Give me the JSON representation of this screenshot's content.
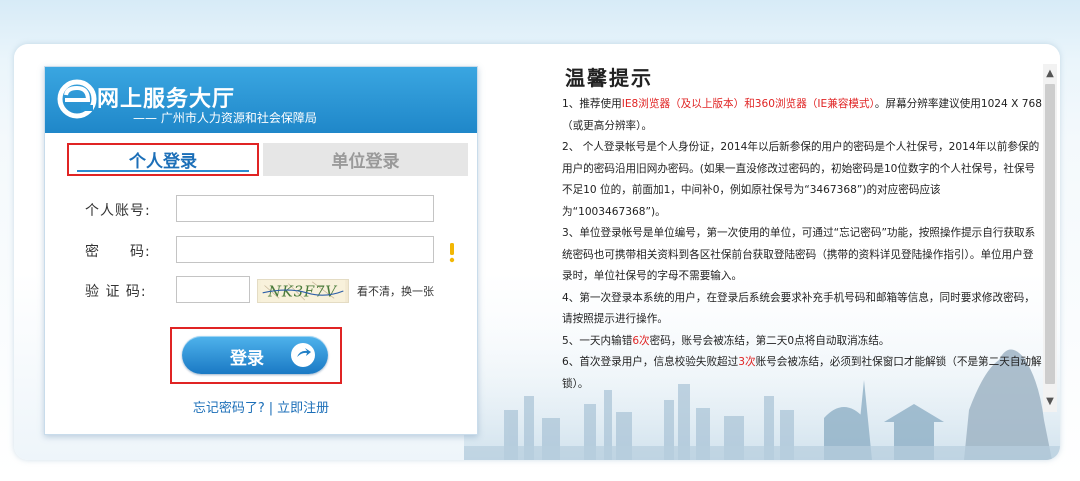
{
  "login": {
    "logo_title": "网上服务大厅",
    "logo_subtitle": "—— 广州市人力资源和社会保障局",
    "tab_personal": "个人登录",
    "tab_unit": "单位登录",
    "account_label": "个人账号:",
    "password_label": "密　　码:",
    "captcha_label": "验 证 码:",
    "account_value": "",
    "password_value": "",
    "captcha_value": "",
    "captcha_text": "NK3F7V",
    "captcha_refresh": "看不清，换一张",
    "submit_label": "登录",
    "forgot_link": "忘记密码了?",
    "link_separator": "|",
    "register_link": "立即注册"
  },
  "tips": {
    "title": "温馨提示",
    "p1": {
      "a": "1、推荐使用",
      "b": "IE8浏览器（及以上版本）和360浏览器（IE兼容模式）",
      "c": "。屏幕分辨率建议使用1024 X 768（或更高分辨率）。"
    },
    "p2": "2、 个人登录帐号是个人身份证，2014年以后新参保的用户的密码是个人社保号，2014年以前参保的用户的密码沿用旧网办密码。(如果一直没修改过密码的，初始密码是10位数字的个人社保号，社保号不足10 位的，前面加1，中间补0，例如原社保号为“3467368”)的对应密码应该为“1003467368”)。",
    "p3": "3、单位登录帐号是单位编号，第一次使用的单位，可通过“忘记密码”功能，按照操作提示自行获取系统密码也可携带相关资料到各区社保前台获取登陆密码（携带的资料详见登陆操作指引）。单位用户登录时，单位社保号的字母不需要输入。",
    "p4": "4、第一次登录本系统的用户，在登录后系统会要求补充手机号码和邮箱等信息，同时要求修改密码，请按照提示进行操作。",
    "p5": {
      "a": "5、一天内输错",
      "b": "6次",
      "c": "密码，账号会被冻结，第二天0点将自动取消冻结。"
    },
    "p6": {
      "a": "6、首次登录用户，信息校验失败超过",
      "b": "3次",
      "c": "账号会被冻结，必须到社保窗口才能解锁（不是第二天自动解锁）。"
    }
  },
  "colors": {
    "brand_blue": "#1f87c9",
    "highlight_red": "#e02424"
  }
}
